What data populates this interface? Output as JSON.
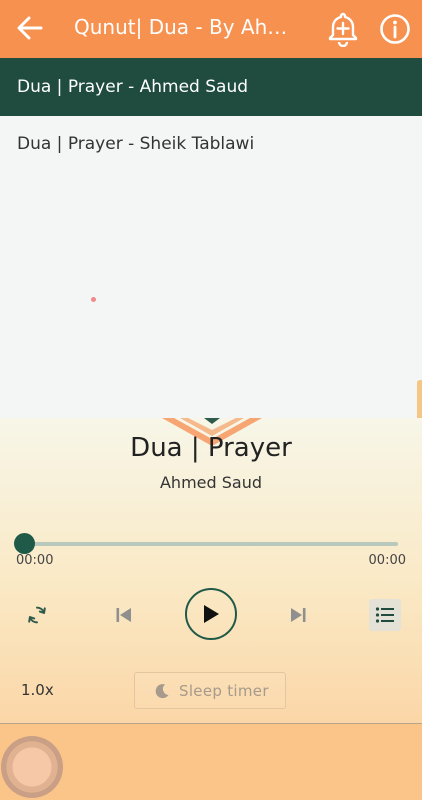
{
  "app_bar": {
    "title": "Qunut| Dua -  By Ahmed Saud",
    "back_icon": "arrow-left-icon",
    "bell_icon": "bell-plus-icon",
    "info_icon": "info-icon",
    "color": "#f7914f"
  },
  "playlist": {
    "items": [
      {
        "label": "Dua | Prayer - Ahmed Saud",
        "active": true
      },
      {
        "label": "Dua | Prayer - Sheik Tablawi",
        "active": false
      }
    ],
    "active_color": "#1f4c3f"
  },
  "player": {
    "track_title": "Dua | Prayer",
    "track_artist": "Ahmed Saud",
    "elapsed": "00:00",
    "duration": "00:00",
    "progress": 0,
    "speed": "1.0x",
    "sleep_timer_label": "Sleep timer",
    "icons": {
      "repeat": "repeat-icon",
      "previous": "skip-previous-icon",
      "play": "play-icon",
      "next": "skip-next-icon",
      "playlist": "list-icon",
      "sleep": "moon-icon"
    },
    "accent_color": "#1f5a48"
  }
}
